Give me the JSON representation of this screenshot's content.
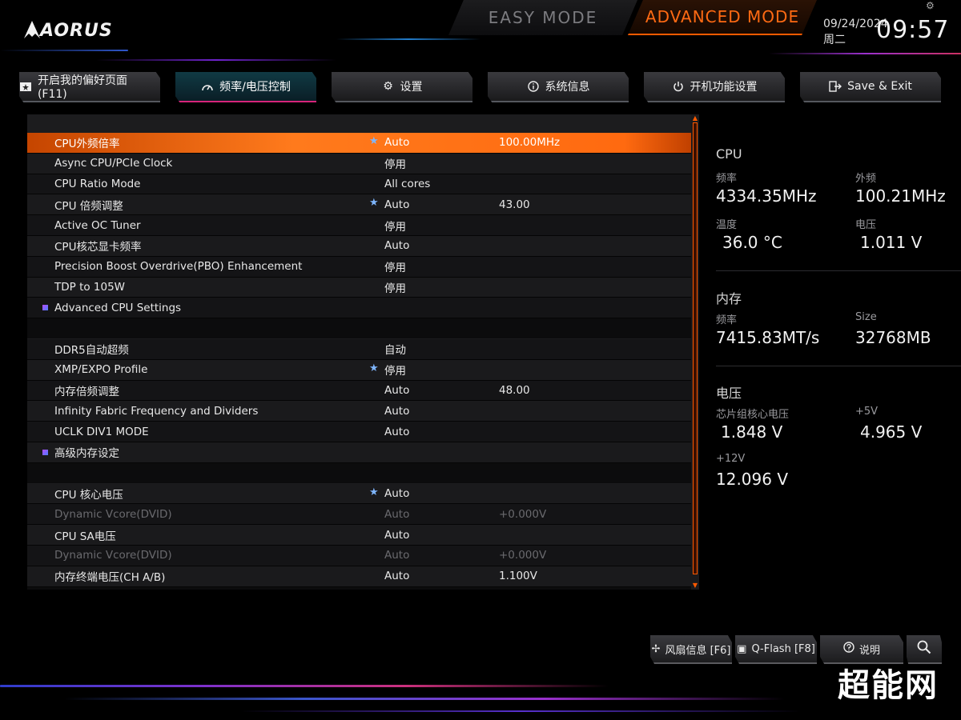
{
  "brand": {
    "logo_text": "AORUS"
  },
  "modes": {
    "easy": "EASY MODE",
    "advanced": "ADVANCED MODE"
  },
  "clock": {
    "date": "09/24/2024",
    "weekday": "周二",
    "time": "09:57"
  },
  "tabs": [
    {
      "label": "开启我的偏好页面 (F11)",
      "icon": "star-page-icon"
    },
    {
      "label": "频率/电压控制",
      "icon": "gauge-icon"
    },
    {
      "label": "设置",
      "icon": "gear-icon"
    },
    {
      "label": "系统信息",
      "icon": "info-icon"
    },
    {
      "label": "开机功能设置",
      "icon": "power-icon"
    },
    {
      "label": "Save & Exit",
      "icon": "exit-icon"
    }
  ],
  "settings": [
    {
      "name": "CPU外频倍率",
      "value": "Auto",
      "value2": "100.00MHz",
      "star": true,
      "selected": true
    },
    {
      "name": "Async CPU/PCIe Clock",
      "value": "停用",
      "value2": ""
    },
    {
      "name": "CPU Ratio Mode",
      "value": "All cores",
      "value2": ""
    },
    {
      "name": "CPU 倍频调整",
      "value": "Auto",
      "value2": "43.00",
      "star": true
    },
    {
      "name": "Active OC Tuner",
      "value": "停用",
      "value2": ""
    },
    {
      "name": "CPU核芯显卡频率",
      "value": "Auto",
      "value2": ""
    },
    {
      "name": "Precision Boost Overdrive(PBO) Enhancement",
      "value": "停用",
      "value2": ""
    },
    {
      "name": "TDP to 105W",
      "value": "停用",
      "value2": ""
    },
    {
      "name": "Advanced CPU Settings",
      "value": "",
      "value2": "",
      "submenu": true
    },
    {
      "blank": true
    },
    {
      "name": "DDR5自动超频",
      "value": "自动",
      "value2": ""
    },
    {
      "name": "XMP/EXPO Profile",
      "value": "停用",
      "value2": "",
      "star": true
    },
    {
      "name": "内存倍频调整",
      "value": "Auto",
      "value2": "48.00"
    },
    {
      "name": "Infinity Fabric Frequency and Dividers",
      "value": "Auto",
      "value2": ""
    },
    {
      "name": "UCLK DIV1 MODE",
      "value": "Auto",
      "value2": ""
    },
    {
      "name": "高级内存设定",
      "value": "",
      "value2": "",
      "submenu": true
    },
    {
      "blank": true
    },
    {
      "name": "CPU 核心电压",
      "value": "Auto",
      "value2": "",
      "star": true
    },
    {
      "name": "Dynamic Vcore(DVID)",
      "value": "Auto",
      "value2": "+0.000V",
      "dim": true
    },
    {
      "name": "CPU SA电压",
      "value": "Auto",
      "value2": ""
    },
    {
      "name": "Dynamic Vcore(DVID)",
      "value": "Auto",
      "value2": "+0.000V",
      "dim": true
    },
    {
      "name": "内存终端电压(CH A/B)",
      "value": "Auto",
      "value2": "1.100V"
    }
  ],
  "info": {
    "cpu": {
      "title": "CPU",
      "freq_label": "频率",
      "freq": "4334.35MHz",
      "bclk_label": "外频",
      "bclk": "100.21MHz",
      "temp_label": "温度",
      "temp": "36.0 °C",
      "volt_label": "电压",
      "volt": "1.011 V"
    },
    "memory": {
      "title": "内存",
      "freq_label": "频率",
      "freq": "7415.83MT/s",
      "size_label": "Size",
      "size": "32768MB"
    },
    "voltage": {
      "title": "电压",
      "chipset_label": "芯片组核心电压",
      "chipset": "1.848 V",
      "v5_label": "+5V",
      "v5": "4.965 V",
      "v12_label": "+12V",
      "v12": "12.096 V"
    }
  },
  "bottom": [
    {
      "label": "风扇信息 [F6]",
      "icon": "fan-icon"
    },
    {
      "label": "Q-Flash [F8]",
      "icon": "chip-icon"
    },
    {
      "label": "说明",
      "icon": "help-icon"
    },
    {
      "label": "",
      "icon": "search-icon"
    }
  ],
  "watermark": "超能网",
  "colors": {
    "accent": "#ff6a13",
    "active_tab_border": "#d6247a",
    "star": "#7fb6ff"
  }
}
